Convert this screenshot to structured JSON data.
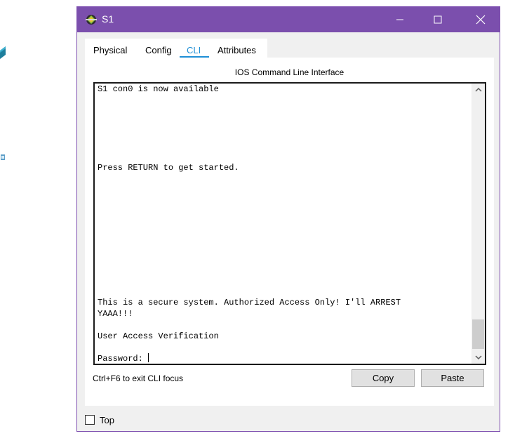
{
  "window": {
    "title": "S1",
    "title_bar_color": "#7b4fad",
    "icon": "packet-tracer-switch-icon"
  },
  "tabs": [
    {
      "label": "Physical",
      "active": false
    },
    {
      "label": "Config",
      "active": false
    },
    {
      "label": "CLI",
      "active": true
    },
    {
      "label": "Attributes",
      "active": false
    }
  ],
  "accent_color": "#1e8fd6",
  "cli": {
    "heading": "IOS Command Line Interface",
    "output": "S1 con0 is now available\n\n\n\n\n\n\nPress RETURN to get started.\n\n\n\n\n\n\n\n\n\n\n\nThis is a secure system. Authorized Access Only! I'll ARREST\nYAAA!!!\n\nUser Access Verification\n\nPassword: "
  },
  "footer": {
    "focus_hint": "Ctrl+F6 to exit CLI focus",
    "copy_label": "Copy",
    "paste_label": "Paste"
  },
  "bottom": {
    "top_checkbox_label": "Top",
    "top_checked": false
  }
}
